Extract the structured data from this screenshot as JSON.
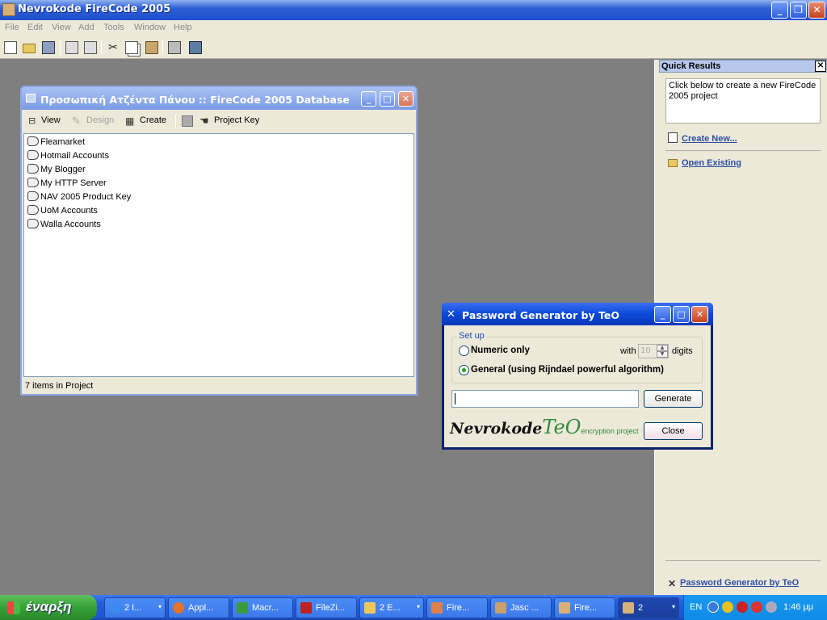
{
  "app": {
    "title": "Nevrokode FireCode 2005"
  },
  "menu": [
    "File",
    "Edit",
    "View",
    "Add",
    "Tools",
    "Window",
    "Help"
  ],
  "toolbar_icons": [
    "new-document-icon",
    "open-folder-icon",
    "save-icon",
    "print-icon",
    "print-preview-icon",
    "cut-icon",
    "copy-icon",
    "paste-icon",
    "password-generator-icon",
    "database-icon"
  ],
  "child_window": {
    "title": "Προσωπική Ατζέντα Πάνου :: FireCode 2005 Database",
    "toolbar": {
      "view": "View",
      "design": "Design",
      "create": "Create",
      "project_key": "Project Key"
    },
    "items": [
      "Fleamarket",
      "Hotmail Accounts",
      "My Blogger",
      "My HTTP Server",
      "NAV 2005 Product Key",
      "UoM Accounts",
      "Walla Accounts"
    ],
    "status": "7 items in Project"
  },
  "quick_results": {
    "title": "Quick Results",
    "close": "✕",
    "description": "Click below to create a new FireCode 2005 project",
    "create_new": "Create New...",
    "open_existing": "Open Existing",
    "password_generator": "Password Generator by TeO"
  },
  "password_generator": {
    "title": "Password Generator by TeO",
    "setup_legend": "Set up",
    "numeric_only": "Numeric only",
    "with": "with",
    "digits_value": "10",
    "digits": "digits",
    "general": "General (using Rijndael powerful algorithm)",
    "generated_value": "",
    "generate_button": "Generate",
    "close_button": "Close",
    "logo_main": "Nevrokode",
    "logo_teo": "TeO",
    "logo_sub": "encryption project",
    "selected_mode": "general"
  },
  "taskbar": {
    "start": "έναρξη",
    "tasks": [
      {
        "label": "2 I...",
        "arrow": "▾"
      },
      {
        "label": "Appl..."
      },
      {
        "label": "Macr..."
      },
      {
        "label": "FileZi..."
      },
      {
        "label": "2 E...",
        "arrow": "▾"
      },
      {
        "label": "Fire..."
      },
      {
        "label": "Jasc ..."
      },
      {
        "label": "Fire..."
      },
      {
        "label": "2",
        "arrow": "▾"
      }
    ],
    "lang": "EN",
    "clock": "1:46 μμ"
  }
}
